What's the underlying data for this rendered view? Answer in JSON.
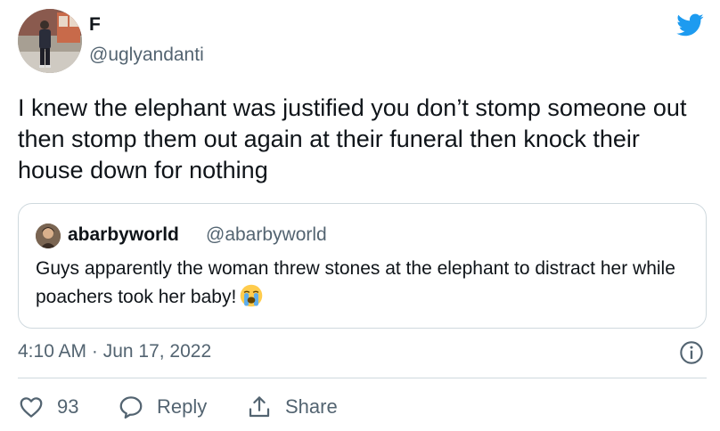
{
  "author": {
    "display_name": "F",
    "handle": "@uglyandanti",
    "avatar_icon": "profile-photo"
  },
  "tweet": {
    "text": "I knew the elephant was justified you don’t stomp someone out then stomp them out again at their funeral then knock their house down for nothing"
  },
  "quoted_tweet": {
    "display_name": "abarbyworld",
    "handle": "@abarbyworld",
    "text": "Guys apparently the woman threw stones at the elephant to distract her while poachers took her baby!",
    "emoji": "loudly-crying-face"
  },
  "meta": {
    "timestamp": "4:10 AM · Jun 17, 2022"
  },
  "actions": {
    "like_count": "93",
    "reply_label": "Reply",
    "share_label": "Share"
  },
  "colors": {
    "brand": "#1d9bf0",
    "secondary_text": "#536471",
    "border": "#cfd9de"
  }
}
